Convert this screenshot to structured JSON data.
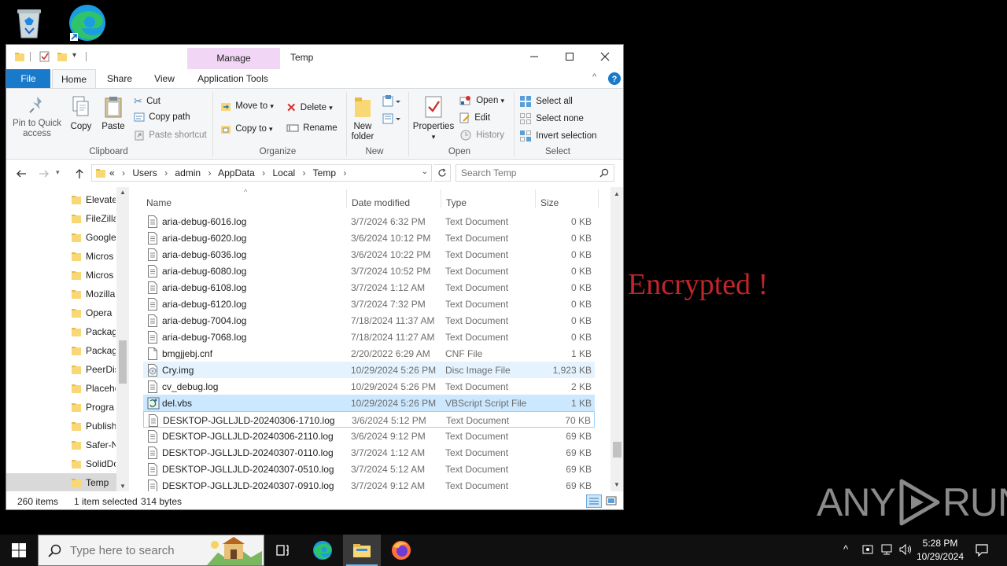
{
  "desktop": {
    "recycle_bin_icon": "recycle-bin-icon",
    "edge_icon": "edge-icon",
    "encrypted_text": "Encrypted !",
    "watermark": {
      "left": "ANY",
      "right": "RUN"
    }
  },
  "window": {
    "title": "Temp",
    "manage_tab": "Manage",
    "tabs": [
      "File",
      "Home",
      "Share",
      "View",
      "Application Tools"
    ]
  },
  "ribbon": {
    "clipboard": {
      "pin": "Pin to Quick access",
      "copy": "Copy",
      "paste": "Paste",
      "cut": "Cut",
      "copy_path": "Copy path",
      "paste_shortcut": "Paste shortcut",
      "label": "Clipboard"
    },
    "organize": {
      "move_to": "Move to",
      "copy_to": "Copy to",
      "delete": "Delete",
      "rename": "Rename",
      "label": "Organize"
    },
    "new": {
      "new_folder": "New folder",
      "label": "New"
    },
    "open": {
      "properties": "Properties",
      "open": "Open",
      "edit": "Edit",
      "history": "History",
      "label": "Open"
    },
    "select": {
      "select_all": "Select all",
      "select_none": "Select none",
      "invert": "Invert selection",
      "label": "Select"
    }
  },
  "address": {
    "overflow": "«",
    "crumbs": [
      "Users",
      "admin",
      "AppData",
      "Local",
      "Temp"
    ],
    "search_placeholder": "Search Temp"
  },
  "nav_items": [
    "Elevate",
    "FileZilla",
    "Google",
    "Micros",
    "Micros",
    "Mozilla",
    "Opera",
    "Packag",
    "Packag",
    "PeerDis",
    "Placeho",
    "Progra",
    "Publish",
    "Safer-N",
    "SolidDo",
    "Temp"
  ],
  "columns": {
    "name": "Name",
    "date": "Date modified",
    "type": "Type",
    "size": "Size"
  },
  "files": [
    {
      "name": "aria-debug-6016.log",
      "date": "3/7/2024 6:32 PM",
      "type": "Text Document",
      "size": "0 KB",
      "icon": "text-file-icon"
    },
    {
      "name": "aria-debug-6020.log",
      "date": "3/6/2024 10:12 PM",
      "type": "Text Document",
      "size": "0 KB",
      "icon": "text-file-icon"
    },
    {
      "name": "aria-debug-6036.log",
      "date": "3/6/2024 10:22 PM",
      "type": "Text Document",
      "size": "0 KB",
      "icon": "text-file-icon"
    },
    {
      "name": "aria-debug-6080.log",
      "date": "3/7/2024 10:52 PM",
      "type": "Text Document",
      "size": "0 KB",
      "icon": "text-file-icon"
    },
    {
      "name": "aria-debug-6108.log",
      "date": "3/7/2024 1:12 AM",
      "type": "Text Document",
      "size": "0 KB",
      "icon": "text-file-icon"
    },
    {
      "name": "aria-debug-6120.log",
      "date": "3/7/2024 7:32 PM",
      "type": "Text Document",
      "size": "0 KB",
      "icon": "text-file-icon"
    },
    {
      "name": "aria-debug-7004.log",
      "date": "7/18/2024 11:37 AM",
      "type": "Text Document",
      "size": "0 KB",
      "icon": "text-file-icon"
    },
    {
      "name": "aria-debug-7068.log",
      "date": "7/18/2024 11:27 AM",
      "type": "Text Document",
      "size": "0 KB",
      "icon": "text-file-icon"
    },
    {
      "name": "bmgjjebj.cnf",
      "date": "2/20/2022 6:29 AM",
      "type": "CNF File",
      "size": "1 KB",
      "icon": "blank-file-icon"
    },
    {
      "name": "Cry.img",
      "date": "10/29/2024 5:26 PM",
      "type": "Disc Image File",
      "size": "1,923 KB",
      "icon": "disc-image-icon"
    },
    {
      "name": "cv_debug.log",
      "date": "10/29/2024 5:26 PM",
      "type": "Text Document",
      "size": "2 KB",
      "icon": "text-file-icon"
    },
    {
      "name": "del.vbs",
      "date": "10/29/2024 5:26 PM",
      "type": "VBScript Script File",
      "size": "1 KB",
      "icon": "vbscript-icon"
    },
    {
      "name": "DESKTOP-JGLLJLD-20240306-1710.log",
      "date": "3/6/2024 5:12 PM",
      "type": "Text Document",
      "size": "70 KB",
      "icon": "text-file-icon"
    },
    {
      "name": "DESKTOP-JGLLJLD-20240306-2110.log",
      "date": "3/6/2024 9:12 PM",
      "type": "Text Document",
      "size": "69 KB",
      "icon": "text-file-icon"
    },
    {
      "name": "DESKTOP-JGLLJLD-20240307-0110.log",
      "date": "3/7/2024 1:12 AM",
      "type": "Text Document",
      "size": "69 KB",
      "icon": "text-file-icon"
    },
    {
      "name": "DESKTOP-JGLLJLD-20240307-0510.log",
      "date": "3/7/2024 5:12 AM",
      "type": "Text Document",
      "size": "69 KB",
      "icon": "text-file-icon"
    },
    {
      "name": "DESKTOP-JGLLJLD-20240307-0910.log",
      "date": "3/7/2024 9:12 AM",
      "type": "Text Document",
      "size": "69 KB",
      "icon": "text-file-icon"
    }
  ],
  "status": {
    "count": "260 items",
    "selected": "1 item selected",
    "bytes": "314 bytes"
  },
  "taskbar": {
    "search_placeholder": "Type here to search",
    "time": "5:28 PM",
    "date": "10/29/2024"
  },
  "colors": {
    "accent": "#1979ca",
    "selection": "#cce8ff",
    "hover": "#e5f3ff",
    "encrypted": "#c0262a",
    "manage_tab": "#f1d7f5"
  }
}
